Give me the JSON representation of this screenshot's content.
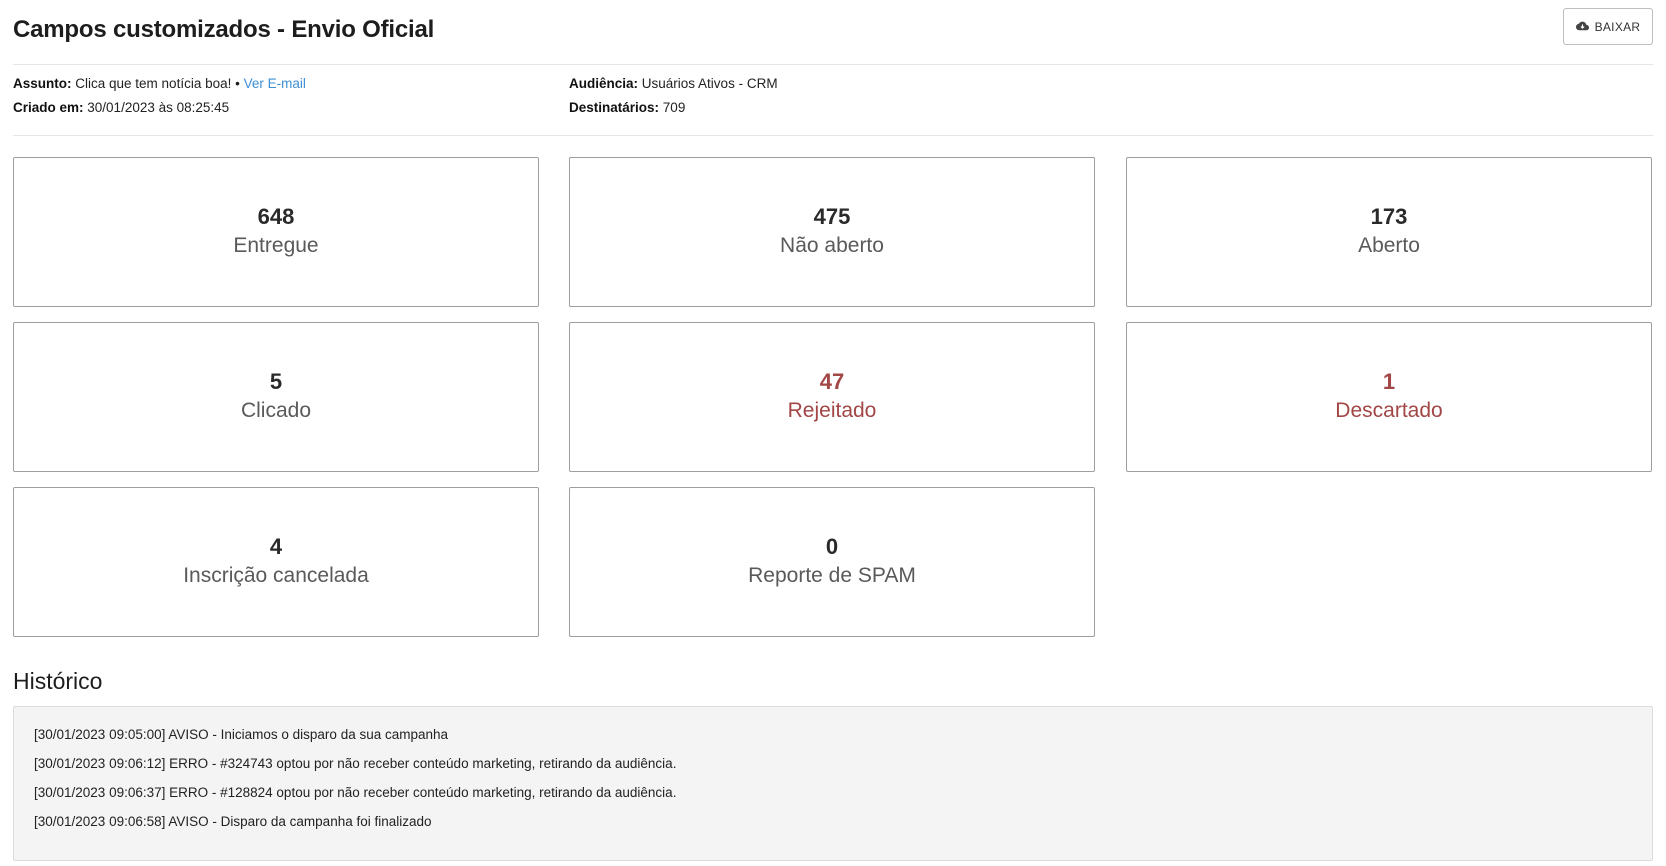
{
  "header": {
    "title": "Campos customizados - Envio Oficial",
    "download_label": "BAIXAR",
    "download_icon": "cloud-download-icon"
  },
  "meta": {
    "subject_label": "Assunto:",
    "subject_value": "Clica que tem notícia boa!",
    "separator": "•",
    "view_email_link": "Ver E-mail",
    "created_label": "Criado em:",
    "created_value": "30/01/2023 às 08:25:45",
    "audience_label": "Audiência:",
    "audience_value": "Usuários Ativos - CRM",
    "recipients_label": "Destinatários:",
    "recipients_value": "709"
  },
  "stats": [
    {
      "value": "648",
      "label": "Entregue",
      "status": "normal"
    },
    {
      "value": "475",
      "label": "Não aberto",
      "status": "normal"
    },
    {
      "value": "173",
      "label": "Aberto",
      "status": "normal"
    },
    {
      "value": "5",
      "label": "Clicado",
      "status": "normal"
    },
    {
      "value": "47",
      "label": "Rejeitado",
      "status": "danger"
    },
    {
      "value": "1",
      "label": "Descartado",
      "status": "danger"
    },
    {
      "value": "4",
      "label": "Inscrição cancelada",
      "status": "normal"
    },
    {
      "value": "0",
      "label": "Reporte de SPAM",
      "status": "normal"
    }
  ],
  "history": {
    "title": "Histórico",
    "entries": [
      "[30/01/2023 09:05:00] AVISO - Iniciamos o disparo da sua campanha",
      "[30/01/2023 09:06:12] ERRO - #324743 optou por não receber conteúdo marketing, retirando da audiência.",
      "[30/01/2023 09:06:37] ERRO - #128824 optou por não receber conteúdo marketing, retirando da audiência.",
      "[30/01/2023 09:06:58] AVISO - Disparo da campanha foi finalizado"
    ]
  },
  "colors": {
    "link": "#3d8fd6",
    "danger": "#a24646",
    "card_border": "#9e9e9e",
    "history_bg": "#f4f4f4"
  }
}
